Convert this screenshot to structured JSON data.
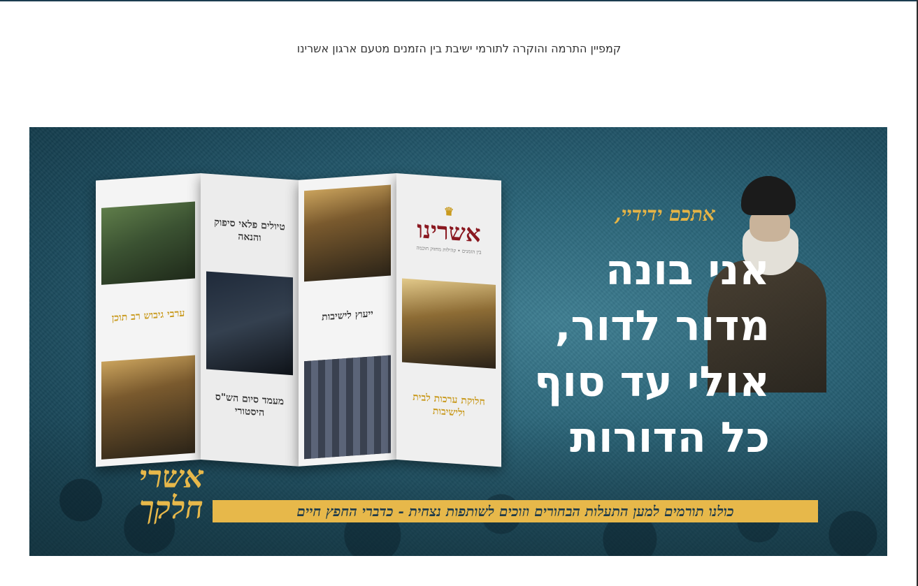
{
  "page": {
    "subtitle": "קמפיין התרמה והוקרה לתורמי ישיבת בין הזמנים מטעם ארגון אשרינו"
  },
  "banner": {
    "eyebrow": "אתכם ידידיי,",
    "headline_lines": [
      "אני בונה",
      "מדור לדור,",
      "אולי עד סוף",
      "כל הדורות"
    ],
    "slogan_lines": [
      "אשרי",
      "חלקך"
    ],
    "strip_text": "כולנו תורמים למען התעלות הבחורים וזוכים לשותפות נצחית - כדברי החפץ חיים",
    "brochure": {
      "logo": "אשרינו",
      "logo_tagline": "בין הזמנים • קהילות מחזוק חוכמה",
      "panel_texts": {
        "trips": "טיולים פלאי סיפוק והנאה",
        "fun_nights": "ערבי גיבוש רב תוכן",
        "advice": "ייעוץ לישיבות",
        "siyum": "מעמד סיום הש\"ס היסטורי",
        "kits": "חלוקת ערכות לבית ולישיבות"
      }
    },
    "colors": {
      "background": "#2a6478",
      "accent_gold": "#e7b84a",
      "logo_red": "#8a1820"
    }
  }
}
